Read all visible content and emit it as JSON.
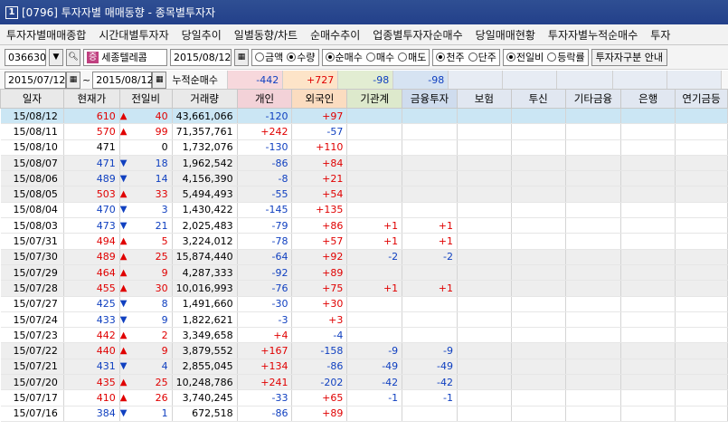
{
  "window": {
    "number": "1",
    "title": "[0796] 투자자별 매매동향 - 종목별투자자"
  },
  "menu": [
    "투자자별매매종합",
    "시간대별투자자",
    "당일추이",
    "일별동향/차트",
    "순매수추이",
    "업종별투자자순매수",
    "당일매매현황",
    "투자자별누적순매수",
    "투자"
  ],
  "toolbar": {
    "code": "036630",
    "name_badge": "증",
    "name": "세종텔레콤",
    "date": "2015/08/12",
    "amount_label": "금액",
    "qty_label": "수량",
    "net_label": "순매수",
    "buy_label": "매수",
    "sell_label": "매도",
    "thousand_label": "천주",
    "single_label": "단주",
    "prev_label": "전일비",
    "rate_label": "등락률",
    "investor_btn": "투자자구분 안내"
  },
  "range": {
    "from": "2015/07/12",
    "sep": "~",
    "to": "2015/08/12",
    "label": "누적순매수",
    "gaein": "-442",
    "foreign": "+727",
    "inst": "-98",
    "fin": "-98"
  },
  "colors": {
    "up": "#e00000",
    "down": "#1040c0",
    "foreign_bg": "#fde4c8",
    "gaein_bg": "#f7d8dc",
    "inst_bg": "#e2edd2",
    "fin_bg": "#d6e3f2"
  },
  "columns": [
    "일자",
    "현재가",
    "전일비",
    "거래량",
    "개인",
    "외국인",
    "기관계",
    "금융투자",
    "보험",
    "투신",
    "기타금융",
    "은행",
    "연기금등"
  ],
  "rows": [
    {
      "date": "15/08/12",
      "price": "610",
      "dir": "up",
      "chg": "40",
      "vol": "43,661,066",
      "gaein": "-120",
      "foreign": "+97",
      "inst": "",
      "fin": ""
    },
    {
      "date": "15/08/11",
      "price": "570",
      "dir": "up",
      "chg": "99",
      "vol": "71,357,761",
      "gaein": "+242",
      "foreign": "-57",
      "inst": "",
      "fin": ""
    },
    {
      "date": "15/08/10",
      "price": "471",
      "dir": "none",
      "chg": "0",
      "vol": "1,732,076",
      "gaein": "-130",
      "foreign": "+110",
      "inst": "",
      "fin": ""
    },
    {
      "date": "15/08/07",
      "price": "471",
      "dir": "down",
      "chg": "18",
      "vol": "1,962,542",
      "gaein": "-86",
      "foreign": "+84",
      "inst": "",
      "fin": ""
    },
    {
      "date": "15/08/06",
      "price": "489",
      "dir": "down",
      "chg": "14",
      "vol": "4,156,390",
      "gaein": "-8",
      "foreign": "+21",
      "inst": "",
      "fin": ""
    },
    {
      "date": "15/08/05",
      "price": "503",
      "dir": "up",
      "chg": "33",
      "vol": "5,494,493",
      "gaein": "-55",
      "foreign": "+54",
      "inst": "",
      "fin": ""
    },
    {
      "date": "15/08/04",
      "price": "470",
      "dir": "down",
      "chg": "3",
      "vol": "1,430,422",
      "gaein": "-145",
      "foreign": "+135",
      "inst": "",
      "fin": ""
    },
    {
      "date": "15/08/03",
      "price": "473",
      "dir": "down",
      "chg": "21",
      "vol": "2,025,483",
      "gaein": "-79",
      "foreign": "+86",
      "inst": "+1",
      "fin": "+1"
    },
    {
      "date": "15/07/31",
      "price": "494",
      "dir": "up",
      "chg": "5",
      "vol": "3,224,012",
      "gaein": "-78",
      "foreign": "+57",
      "inst": "+1",
      "fin": "+1"
    },
    {
      "date": "15/07/30",
      "price": "489",
      "dir": "up",
      "chg": "25",
      "vol": "15,874,440",
      "gaein": "-64",
      "foreign": "+92",
      "inst": "-2",
      "fin": "-2"
    },
    {
      "date": "15/07/29",
      "price": "464",
      "dir": "up",
      "chg": "9",
      "vol": "4,287,333",
      "gaein": "-92",
      "foreign": "+89",
      "inst": "",
      "fin": ""
    },
    {
      "date": "15/07/28",
      "price": "455",
      "dir": "up",
      "chg": "30",
      "vol": "10,016,993",
      "gaein": "-76",
      "foreign": "+75",
      "inst": "+1",
      "fin": "+1"
    },
    {
      "date": "15/07/27",
      "price": "425",
      "dir": "down",
      "chg": "8",
      "vol": "1,491,660",
      "gaein": "-30",
      "foreign": "+30",
      "inst": "",
      "fin": ""
    },
    {
      "date": "15/07/24",
      "price": "433",
      "dir": "down",
      "chg": "9",
      "vol": "1,822,621",
      "gaein": "-3",
      "foreign": "+3",
      "inst": "",
      "fin": ""
    },
    {
      "date": "15/07/23",
      "price": "442",
      "dir": "up",
      "chg": "2",
      "vol": "3,349,658",
      "gaein": "+4",
      "foreign": "-4",
      "inst": "",
      "fin": ""
    },
    {
      "date": "15/07/22",
      "price": "440",
      "dir": "up",
      "chg": "9",
      "vol": "3,879,552",
      "gaein": "+167",
      "foreign": "-158",
      "inst": "-9",
      "fin": "-9"
    },
    {
      "date": "15/07/21",
      "price": "431",
      "dir": "down",
      "chg": "4",
      "vol": "2,855,045",
      "gaein": "+134",
      "foreign": "-86",
      "inst": "-49",
      "fin": "-49"
    },
    {
      "date": "15/07/20",
      "price": "435",
      "dir": "up",
      "chg": "25",
      "vol": "10,248,786",
      "gaein": "+241",
      "foreign": "-202",
      "inst": "-42",
      "fin": "-42"
    },
    {
      "date": "15/07/17",
      "price": "410",
      "dir": "up",
      "chg": "26",
      "vol": "3,740,245",
      "gaein": "-33",
      "foreign": "+65",
      "inst": "-1",
      "fin": "-1"
    },
    {
      "date": "15/07/16",
      "price": "384",
      "dir": "down",
      "chg": "1",
      "vol": "672,518",
      "gaein": "-86",
      "foreign": "+89",
      "inst": "",
      "fin": ""
    }
  ]
}
